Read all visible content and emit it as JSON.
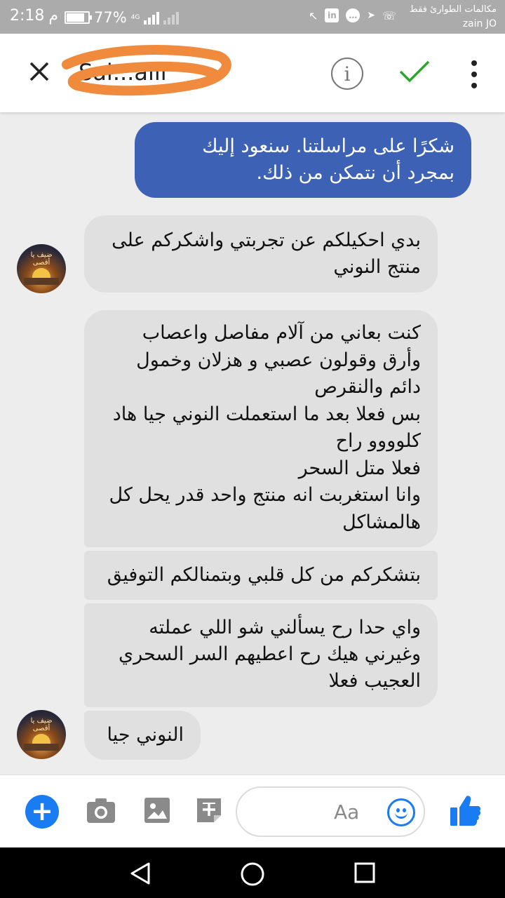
{
  "status_bar": {
    "time": "2:18",
    "time_suffix": "م",
    "battery": "77%",
    "battery_level": 0.77,
    "network": "4G",
    "carrier_line1": "مكالمات الطوارئ فقط",
    "carrier_line2": "zain JO"
  },
  "header": {
    "contact_name": "Sal...aili"
  },
  "messages": [
    {
      "direction": "outgoing",
      "text": "شكرًا على مراسلتنا. سنعود إليك بمجرد أن نتمكن من ذلك."
    },
    {
      "direction": "incoming",
      "text": "بدي احكيلكم عن تجربتي واشكركم على منتج النوني"
    },
    {
      "direction": "incoming",
      "text": "كنت بعاني من آلام مفاصل واعصاب وأرق وقولون عصبي و هزلان وخمول دائم والنقرص\nبس فعلا بعد ما استعملت النوني جيا هاد كلوووو راح\nفعلا متل السحر\nوانا استغربت انه منتج واحد قدر يحل كل هالمشاكل"
    },
    {
      "direction": "incoming",
      "text": "بتشكركم من كل قلبي وبتمنالكم التوفيق"
    },
    {
      "direction": "incoming",
      "text": "واي حدا رح يسألني شو اللي عملته وغيرني هيك رح اعطيهم السر السحري العجيب فعلا"
    },
    {
      "direction": "incoming",
      "text": "النوني جيا"
    }
  ],
  "avatar_text": "ضيف يا أقصى",
  "composer": {
    "placeholder": "Aa"
  },
  "colors": {
    "accent": "#1a7cf2",
    "outgoing_bubble": "#3d62b5",
    "incoming_bubble": "#e0e0e0",
    "check": "#2ea52e",
    "scribble": "#f08a3c"
  }
}
